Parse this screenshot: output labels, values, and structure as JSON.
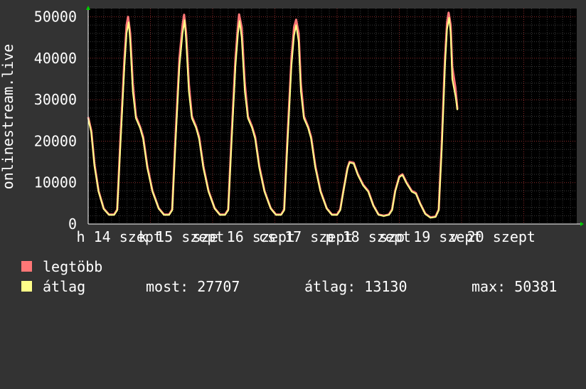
{
  "chart_data": {
    "type": "area",
    "ylabel": "onlinestream.live",
    "ylim": [
      0,
      52000
    ],
    "yticks": [
      0,
      10000,
      20000,
      30000,
      40000,
      50000
    ],
    "xticks": [
      "h 14 szept",
      "k 15 szept",
      "sze 16 szept",
      "cs 17 szept",
      "p 18 szept",
      "szo 19 szept",
      "v 20 szept"
    ],
    "grid": true,
    "series": [
      {
        "name": "legtöbb",
        "color": "#ff7777",
        "points": [
          [
            0,
            25800
          ],
          [
            0.3,
            22500
          ],
          [
            0.6,
            14500
          ],
          [
            1,
            8000
          ],
          [
            1.5,
            3700
          ],
          [
            2,
            2300
          ],
          [
            2.5,
            2300
          ],
          [
            2.8,
            3500
          ],
          [
            3.1,
            20000
          ],
          [
            3.5,
            40000
          ],
          [
            3.7,
            48000
          ],
          [
            3.85,
            50000
          ],
          [
            4.05,
            46000
          ],
          [
            4.3,
            34000
          ],
          [
            4.6,
            26000
          ],
          [
            5,
            23500
          ],
          [
            5.3,
            21000
          ],
          [
            5.7,
            14000
          ],
          [
            6.2,
            8000
          ],
          [
            6.8,
            3800
          ],
          [
            7.3,
            2300
          ],
          [
            7.8,
            2300
          ],
          [
            8.1,
            3500
          ],
          [
            8.4,
            20000
          ],
          [
            8.8,
            40000
          ],
          [
            9.1,
            48000
          ],
          [
            9.25,
            50500
          ],
          [
            9.45,
            46000
          ],
          [
            9.7,
            34000
          ],
          [
            10,
            26000
          ],
          [
            10.4,
            23500
          ],
          [
            10.7,
            21000
          ],
          [
            11.1,
            14000
          ],
          [
            11.6,
            8000
          ],
          [
            12.2,
            3800
          ],
          [
            12.7,
            2300
          ],
          [
            13.2,
            2300
          ],
          [
            13.5,
            3500
          ],
          [
            13.8,
            20000
          ],
          [
            14.2,
            40000
          ],
          [
            14.45,
            48000
          ],
          [
            14.55,
            50600
          ],
          [
            14.8,
            47500
          ],
          [
            15.1,
            34000
          ],
          [
            15.4,
            26000
          ],
          [
            15.8,
            23500
          ],
          [
            16.1,
            21000
          ],
          [
            16.5,
            14000
          ],
          [
            17,
            8000
          ],
          [
            17.6,
            3800
          ],
          [
            18.1,
            2300
          ],
          [
            18.6,
            2300
          ],
          [
            18.9,
            3500
          ],
          [
            19.2,
            20000
          ],
          [
            19.6,
            40000
          ],
          [
            19.85,
            47500
          ],
          [
            20.05,
            49300
          ],
          [
            20.3,
            46000
          ],
          [
            20.5,
            34000
          ],
          [
            20.8,
            26000
          ],
          [
            21.2,
            23500
          ],
          [
            21.5,
            21000
          ],
          [
            21.9,
            14000
          ],
          [
            22.4,
            8000
          ],
          [
            23,
            3800
          ],
          [
            23.5,
            2300
          ],
          [
            24,
            2300
          ],
          [
            24.3,
            3500
          ],
          [
            24.6,
            8000
          ],
          [
            25,
            13500
          ],
          [
            25.2,
            15000
          ],
          [
            25.6,
            14800
          ],
          [
            26,
            12000
          ],
          [
            26.5,
            9500
          ],
          [
            27,
            8000
          ],
          [
            27.5,
            4500
          ],
          [
            28,
            2300
          ],
          [
            28.5,
            2000
          ],
          [
            29,
            2300
          ],
          [
            29.3,
            3500
          ],
          [
            29.6,
            8000
          ],
          [
            30,
            11500
          ],
          [
            30.3,
            12000
          ],
          [
            30.7,
            10000
          ],
          [
            31.2,
            8000
          ],
          [
            31.6,
            7500
          ],
          [
            32,
            5000
          ],
          [
            32.5,
            2500
          ],
          [
            33,
            1600
          ],
          [
            33.5,
            1800
          ],
          [
            33.8,
            3500
          ],
          [
            34.1,
            20000
          ],
          [
            34.4,
            40000
          ],
          [
            34.6,
            48500
          ],
          [
            34.75,
            51000
          ],
          [
            34.95,
            48000
          ],
          [
            35.1,
            38000
          ],
          [
            35.4,
            33000
          ],
          [
            35.6,
            27707
          ]
        ]
      },
      {
        "name": "átlag",
        "color": "#ffff88",
        "points": [
          [
            0,
            25500
          ],
          [
            0.3,
            22000
          ],
          [
            0.6,
            14000
          ],
          [
            1,
            7800
          ],
          [
            1.5,
            3600
          ],
          [
            2,
            2200
          ],
          [
            2.5,
            2200
          ],
          [
            2.8,
            3300
          ],
          [
            3.1,
            18500
          ],
          [
            3.5,
            38000
          ],
          [
            3.7,
            46000
          ],
          [
            3.9,
            48700
          ],
          [
            4.05,
            44000
          ],
          [
            4.3,
            32000
          ],
          [
            4.6,
            25500
          ],
          [
            5,
            23200
          ],
          [
            5.3,
            20500
          ],
          [
            5.7,
            13500
          ],
          [
            6.2,
            7800
          ],
          [
            6.8,
            3700
          ],
          [
            7.3,
            2200
          ],
          [
            7.8,
            2200
          ],
          [
            8.1,
            3300
          ],
          [
            8.4,
            18500
          ],
          [
            8.8,
            38000
          ],
          [
            9.1,
            46000
          ],
          [
            9.3,
            49200
          ],
          [
            9.45,
            44000
          ],
          [
            9.7,
            32000
          ],
          [
            10,
            25500
          ],
          [
            10.4,
            23200
          ],
          [
            10.7,
            20500
          ],
          [
            11.1,
            13500
          ],
          [
            11.6,
            7800
          ],
          [
            12.2,
            3700
          ],
          [
            12.7,
            2200
          ],
          [
            13.2,
            2200
          ],
          [
            13.5,
            3300
          ],
          [
            13.8,
            18500
          ],
          [
            14.2,
            38000
          ],
          [
            14.45,
            46000
          ],
          [
            14.6,
            49000
          ],
          [
            14.8,
            45000
          ],
          [
            15.1,
            32000
          ],
          [
            15.4,
            25500
          ],
          [
            15.8,
            23200
          ],
          [
            16.1,
            20500
          ],
          [
            16.5,
            13500
          ],
          [
            17,
            7800
          ],
          [
            17.6,
            3700
          ],
          [
            18.1,
            2200
          ],
          [
            18.6,
            2200
          ],
          [
            18.9,
            3300
          ],
          [
            19.2,
            18500
          ],
          [
            19.6,
            38000
          ],
          [
            19.85,
            45500
          ],
          [
            20.05,
            48000
          ],
          [
            20.3,
            44000
          ],
          [
            20.5,
            32000
          ],
          [
            20.8,
            25500
          ],
          [
            21.2,
            23200
          ],
          [
            21.5,
            20500
          ],
          [
            21.9,
            13500
          ],
          [
            22.4,
            7800
          ],
          [
            23,
            3700
          ],
          [
            23.5,
            2200
          ],
          [
            24,
            2200
          ],
          [
            24.3,
            3300
          ],
          [
            24.6,
            7800
          ],
          [
            25,
            13300
          ],
          [
            25.2,
            14800
          ],
          [
            25.6,
            14600
          ],
          [
            26,
            11800
          ],
          [
            26.5,
            9300
          ],
          [
            27,
            7800
          ],
          [
            27.5,
            4400
          ],
          [
            28,
            2200
          ],
          [
            28.5,
            1900
          ],
          [
            29,
            2200
          ],
          [
            29.3,
            3300
          ],
          [
            29.6,
            7800
          ],
          [
            30,
            11300
          ],
          [
            30.3,
            11800
          ],
          [
            30.7,
            9800
          ],
          [
            31.2,
            7800
          ],
          [
            31.6,
            7300
          ],
          [
            32,
            4900
          ],
          [
            32.5,
            2400
          ],
          [
            33,
            1500
          ],
          [
            33.5,
            1700
          ],
          [
            33.8,
            3300
          ],
          [
            34.1,
            18500
          ],
          [
            34.4,
            38000
          ],
          [
            34.6,
            47000
          ],
          [
            34.8,
            49800
          ],
          [
            34.95,
            46000
          ],
          [
            35.1,
            35000
          ],
          [
            35.4,
            31000
          ],
          [
            35.6,
            27500
          ]
        ]
      }
    ],
    "legend": {
      "position": "bottom",
      "entries": [
        {
          "label": "legtöbb",
          "color": "#ff7777"
        },
        {
          "label": "átlag",
          "color": "#ffff88"
        }
      ]
    },
    "stats": {
      "most": "most: 27707",
      "atlag": "átlag: 13130",
      "max": "max: 50381"
    }
  }
}
